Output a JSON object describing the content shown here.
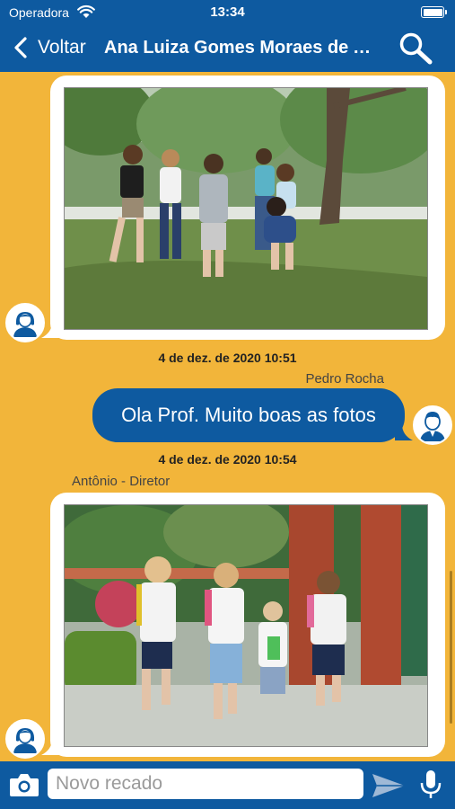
{
  "status_bar": {
    "carrier": "Operadora",
    "time": "13:34"
  },
  "nav": {
    "back_label": "Voltar",
    "title": "Ana Luiza Gomes Moraes de Almeida"
  },
  "messages": [
    {
      "type": "image",
      "direction": "incoming",
      "timestamp": "4 de dez. de 2020 10:51",
      "photo_icon": "children-playing-park-photo"
    },
    {
      "type": "text",
      "direction": "outgoing",
      "sender": "Pedro Rocha",
      "text": "Ola Prof. Muito boas as fotos",
      "timestamp": "4 de dez. de 2020 10:54"
    },
    {
      "type": "image",
      "direction": "incoming",
      "sender": "Antônio - Diretor",
      "photo_icon": "children-running-school-photo"
    }
  ],
  "composer": {
    "placeholder": "Novo recado"
  },
  "colors": {
    "primary": "#0E5AA0",
    "background": "#F2B53A",
    "bubble_white": "#FFFFFF"
  }
}
